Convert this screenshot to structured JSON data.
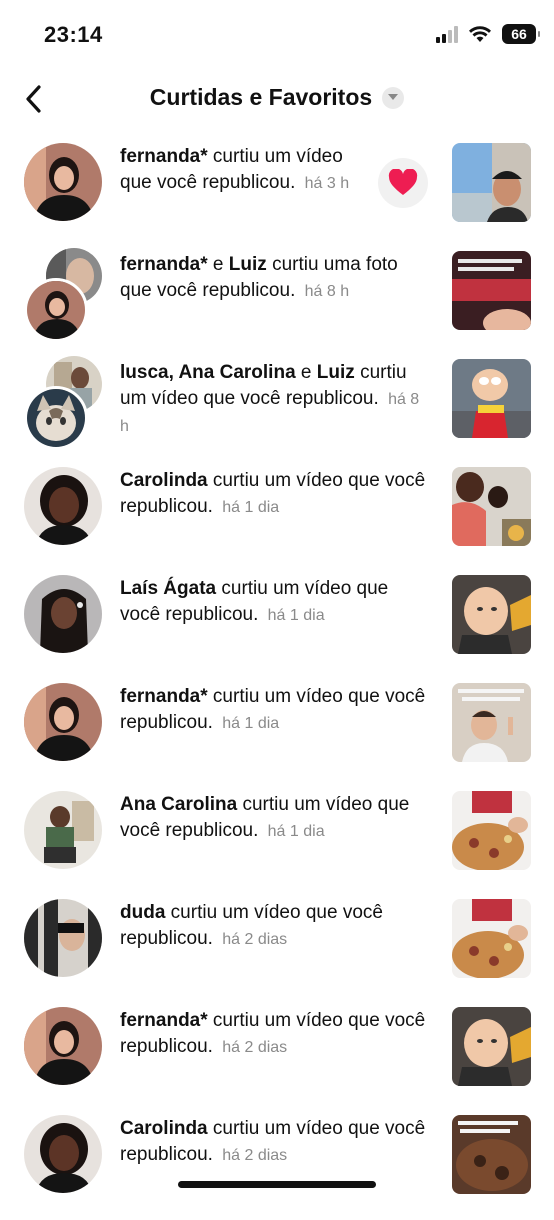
{
  "status_bar": {
    "time": "23:14",
    "battery": "66",
    "icons": [
      "signal-icon",
      "wifi-icon",
      "battery-icon"
    ]
  },
  "header": {
    "title": "Curtidas e Favoritos",
    "back_icon": "chevron-left-icon",
    "dropdown_icon": "caret-down-icon"
  },
  "notifications": [
    {
      "names": "fernanda*",
      "action": "curtiu um vídeo que você republicou.",
      "time": "há 3 h",
      "liked_icon": "heart-icon"
    },
    {
      "names": "fernanda*",
      "connector": "e",
      "names2": "Luiz",
      "action": "curtiu uma foto que você republicou.",
      "time": "há 8 h"
    },
    {
      "names": "lusca, Ana Carolina",
      "connector": "e",
      "names2": "Luiz",
      "action": "curtiu um vídeo que você republicou.",
      "time": "há 8 h"
    },
    {
      "names": "Carolinda",
      "action": "curtiu um vídeo que você republicou.",
      "time": "há 1 dia"
    },
    {
      "names": "Laís Ágata",
      "action": "curtiu um vídeo que você republicou.",
      "time": "há 1 dia"
    },
    {
      "names": "fernanda*",
      "action": "curtiu um vídeo que você republicou.",
      "time": "há 1 dia"
    },
    {
      "names": "Ana Carolina",
      "action": "curtiu um vídeo que você republicou.",
      "time": "há 1 dia"
    },
    {
      "names": "duda",
      "action": "curtiu um vídeo que você republicou.",
      "time": "há 2 dias"
    },
    {
      "names": "fernanda*",
      "action": "curtiu um vídeo que você republicou.",
      "time": "há 2 dias"
    },
    {
      "names": "Carolinda",
      "action": "curtiu um vídeo que você republicou.",
      "time": "há 2 dias"
    }
  ],
  "colors": {
    "text": "#111111",
    "muted": "#8a8a8a",
    "heart": "#ee1d52",
    "heart_bg": "#f1f1f1"
  }
}
